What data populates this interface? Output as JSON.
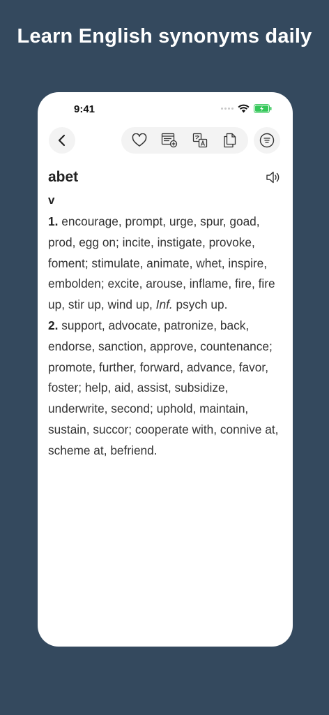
{
  "banner": {
    "title": "Learn English synonyms daily"
  },
  "status": {
    "time": "9:41"
  },
  "entry": {
    "word": "abet",
    "pos": "v",
    "senses": [
      {
        "num": "1.",
        "text_a": " encourage, prompt, urge, spur, goad, prod, egg on; incite, instigate, provoke, foment; stimulate, animate, whet, inspire, embolden; excite, arouse, inflame, fire, fire up, stir up, wind up, ",
        "italic": "Inf.",
        "text_b": " psych up."
      },
      {
        "num": "2.",
        "text": " support, advocate, patronize, back, endorse, sanction, approve, countenance; promote, further, forward, advance, favor, foster; help, aid, assist, subsidize, underwrite, second; uphold, maintain, sustain, succor; cooperate with, connive at, scheme at, befriend."
      }
    ]
  },
  "icons": {
    "back": "chevron-left-icon",
    "favorite": "heart-icon",
    "flashcard": "add-to-list-icon",
    "translate": "translate-icon",
    "copy": "copy-icon",
    "menu": "menu-icon",
    "audio": "speaker-icon"
  },
  "colors": {
    "background": "#34495e",
    "card": "#ffffff",
    "battery": "#34c759"
  }
}
